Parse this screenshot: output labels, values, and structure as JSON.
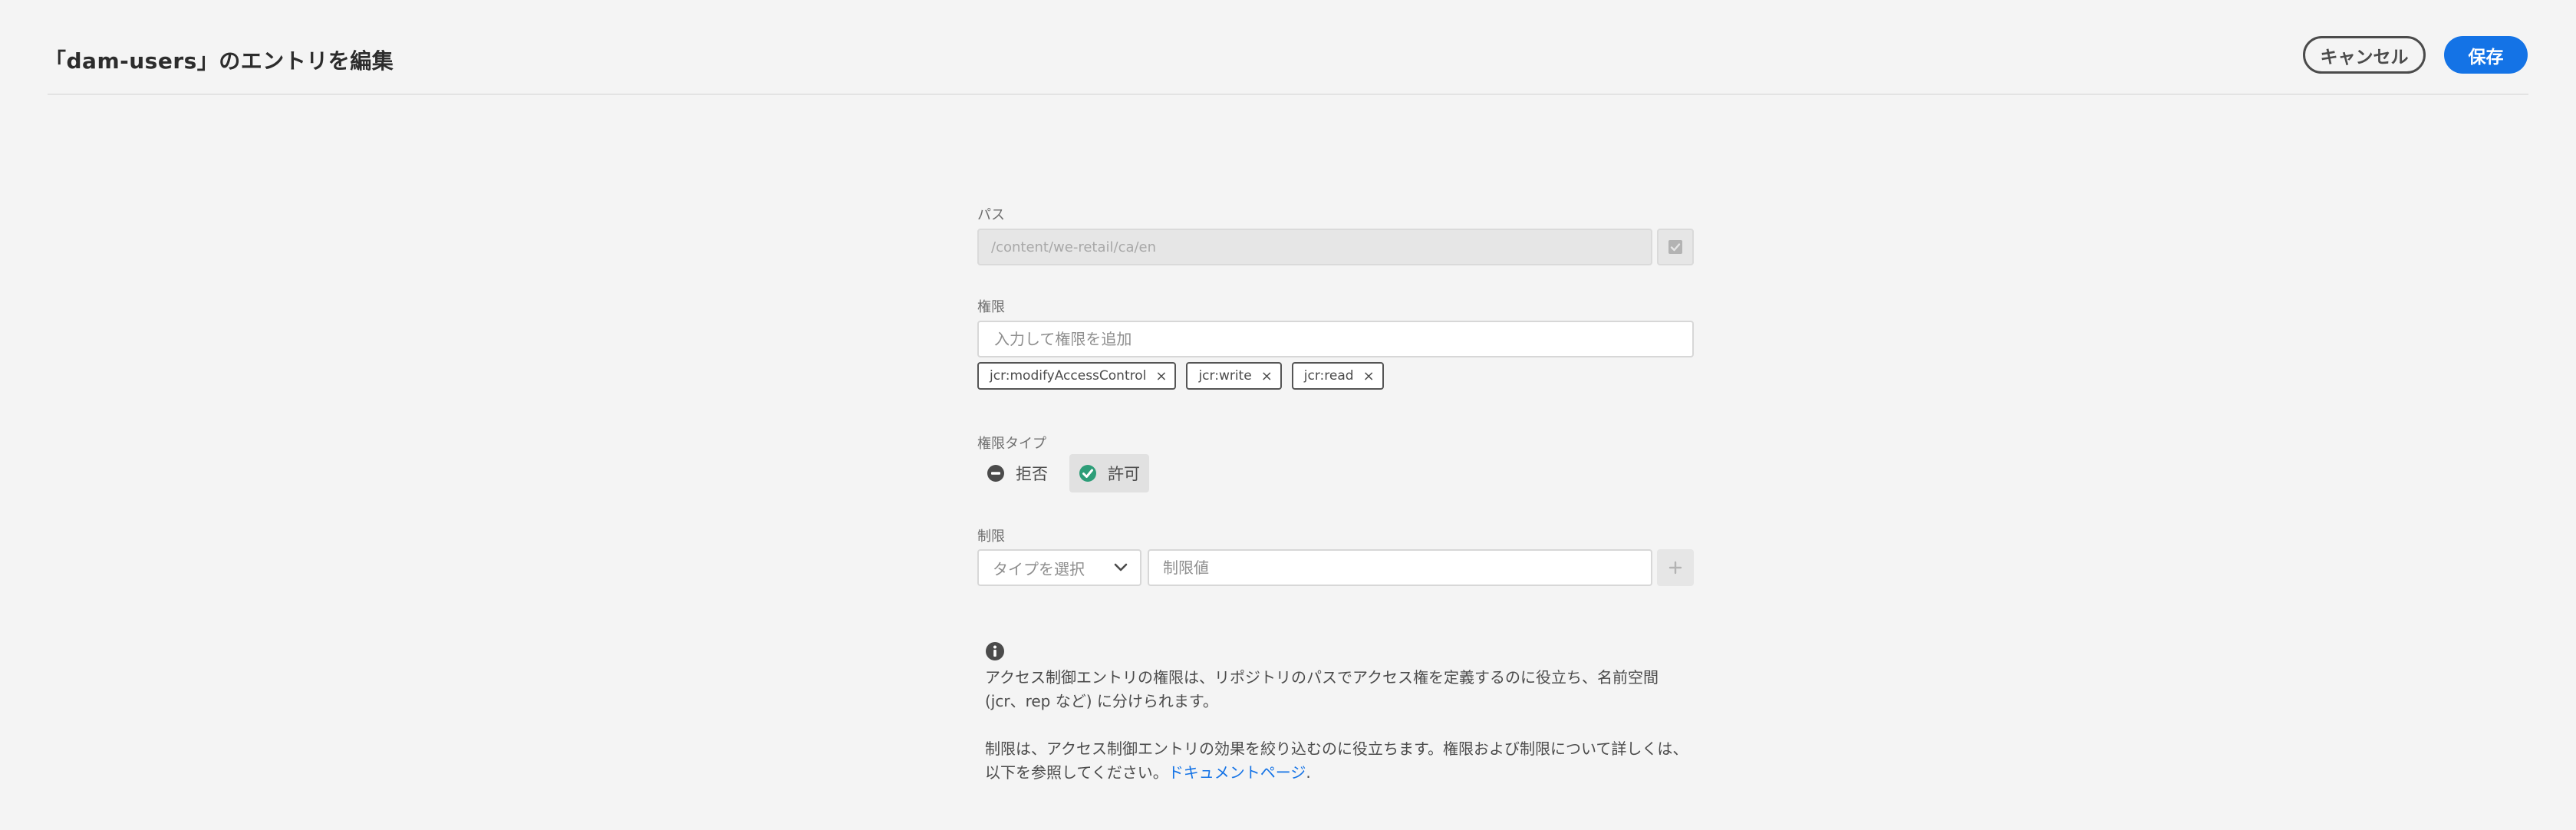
{
  "header": {
    "title": "「dam-users」のエントリを編集",
    "cancel_label": "キャンセル",
    "save_label": "保存"
  },
  "form": {
    "path": {
      "label": "パス",
      "value": "/content/we-retail/ca/en"
    },
    "privileges": {
      "label": "権限",
      "placeholder": "入力して権限を追加",
      "tags": [
        "jcr:modifyAccessControl",
        "jcr:write",
        "jcr:read"
      ],
      "remove_glyph": "×"
    },
    "privilege_type": {
      "label": "権限タイプ",
      "options": [
        {
          "label": "拒否",
          "icon": "deny-icon",
          "selected": false
        },
        {
          "label": "許可",
          "icon": "allow-check-icon",
          "selected": true
        }
      ]
    },
    "restrictions": {
      "label": "制限",
      "type_placeholder": "タイプを選択",
      "value_placeholder": "制限値"
    },
    "info": {
      "paragraph1": "アクセス制御エントリの権限は、リポジトリのパスでアクセス権を定義するのに役立ち、名前空間 (jcr、rep など) に分けられます。",
      "paragraph2_text": "制限は、アクセス制御エントリの効果を絞り込むのに役立ちます。権限および制限について詳しくは、以下を参照してください。",
      "link_text": "ドキュメントページ",
      "period": "."
    }
  },
  "colors": {
    "background": "#f4f4f4",
    "accent": "#1473e6",
    "allow_green": "#2d9d78",
    "text": "#4b4b4b"
  }
}
